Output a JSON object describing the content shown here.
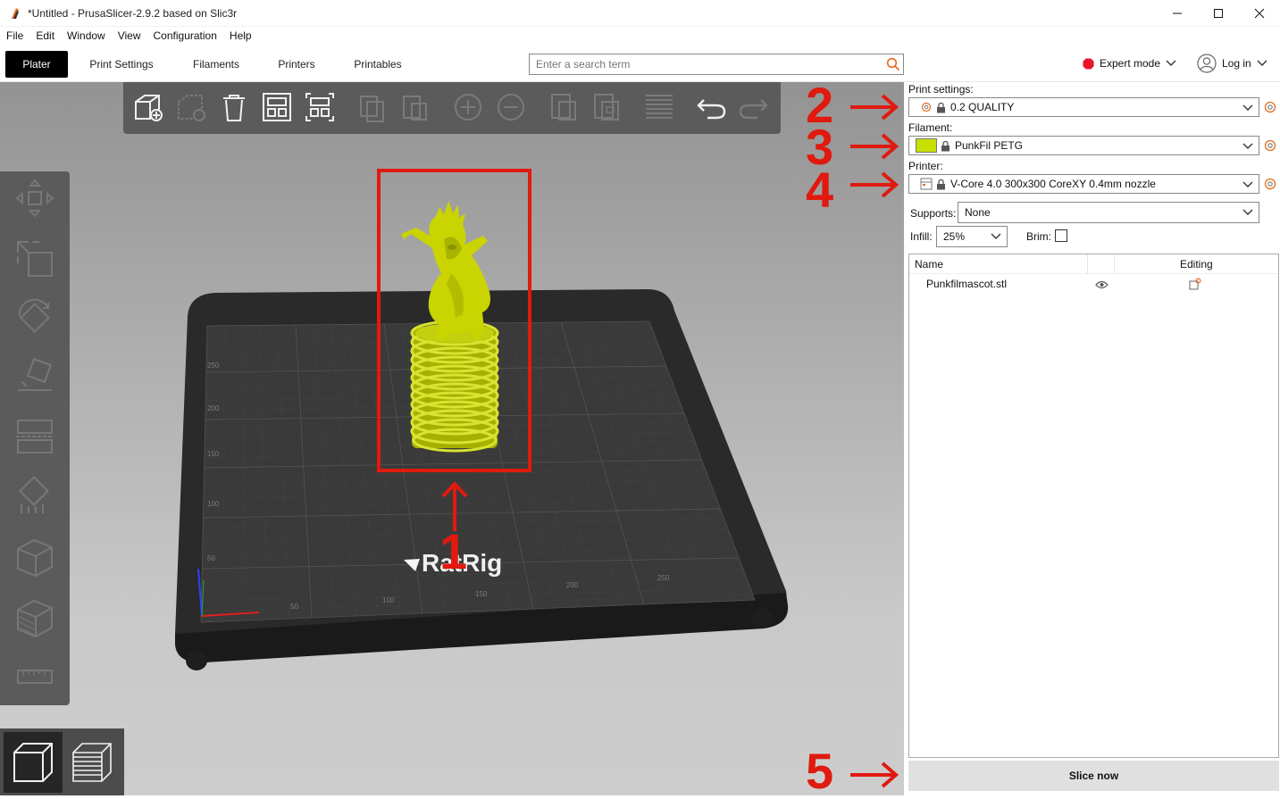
{
  "window": {
    "title": "*Untitled - PrusaSlicer-2.9.2 based on Slic3r",
    "controls": [
      "—",
      "☐",
      "✕"
    ]
  },
  "menu": [
    "File",
    "Edit",
    "Window",
    "View",
    "Configuration",
    "Help"
  ],
  "tabs": [
    {
      "label": "Plater",
      "active": true
    },
    {
      "label": "Print Settings",
      "active": false
    },
    {
      "label": "Filaments",
      "active": false
    },
    {
      "label": "Printers",
      "active": false
    },
    {
      "label": "Printables",
      "active": false
    }
  ],
  "search": {
    "placeholder": "Enter a search term"
  },
  "mode": {
    "label": "Expert mode",
    "color": "#e8142b"
  },
  "account": {
    "label": "Log in"
  },
  "sidebar": {
    "print_settings": {
      "label": "Print settings:",
      "value": "0.2 QUALITY"
    },
    "filament": {
      "label": "Filament:",
      "value": "PunkFil PETG",
      "color": "#c8e000"
    },
    "printer": {
      "label": "Printer:",
      "value": "V-Core 4.0 300x300 CoreXY 0.4mm nozzle"
    },
    "supports": {
      "label": "Supports:",
      "value": "None"
    },
    "infill": {
      "label": "Infill:",
      "value": "25%"
    },
    "brim": {
      "label": "Brim:",
      "checked": false
    },
    "objects": {
      "col_name": "Name",
      "col_editing": "Editing",
      "items": [
        {
          "name": "Punkfilmascot.stl"
        }
      ]
    },
    "slice_button": "Slice now"
  },
  "bed": {
    "logo": "RatRig",
    "x_ticks": [
      "50",
      "100",
      "150",
      "200",
      "250"
    ],
    "y_ticks": [
      "50",
      "100",
      "150",
      "200",
      "250"
    ],
    "model_color": "#c9d400"
  },
  "annotations": {
    "n1": "1",
    "n2": "2",
    "n3": "3",
    "n4": "4",
    "n5": "5",
    "color": "#e01a0f"
  }
}
